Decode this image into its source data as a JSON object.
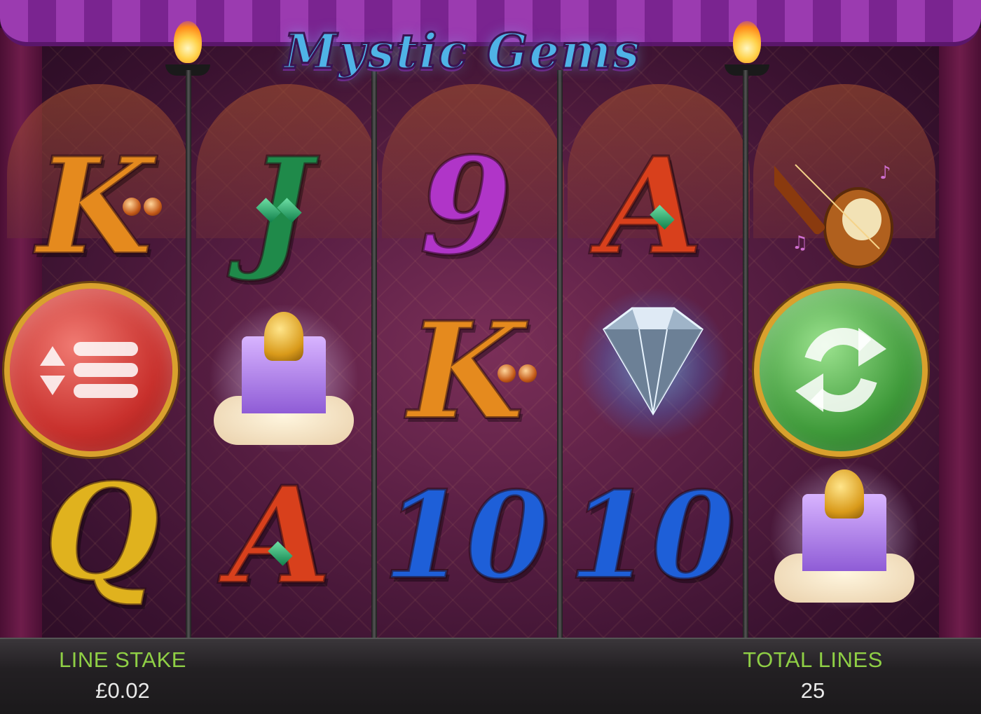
{
  "game": {
    "title": "Mystic Gems"
  },
  "reels": [
    [
      "K",
      "menu-button",
      "Q"
    ],
    [
      "J",
      "palace",
      "A"
    ],
    [
      "9",
      "K",
      "10"
    ],
    [
      "A",
      "diamond",
      "10"
    ],
    [
      "instrument",
      "spin-button",
      "palace"
    ]
  ],
  "symbol_colors": {
    "K": "#e58a1e",
    "Q": "#e0b21e",
    "J": "#1f8a4a",
    "A": "#d8401c",
    "9": "#b035c8",
    "10": "#1e5fd8"
  },
  "buttons": {
    "menu_icon": "menu-icon",
    "spin_icon": "refresh-icon",
    "menu_color": "#c8302c",
    "spin_color": "#3f9a3a"
  },
  "bottom_bar": {
    "line_stake_label": "LINE STAKE",
    "line_stake_value": "£0.02",
    "total_lines_label": "TOTAL LINES",
    "total_lines_value": "25",
    "label_color": "#8fcf45"
  }
}
